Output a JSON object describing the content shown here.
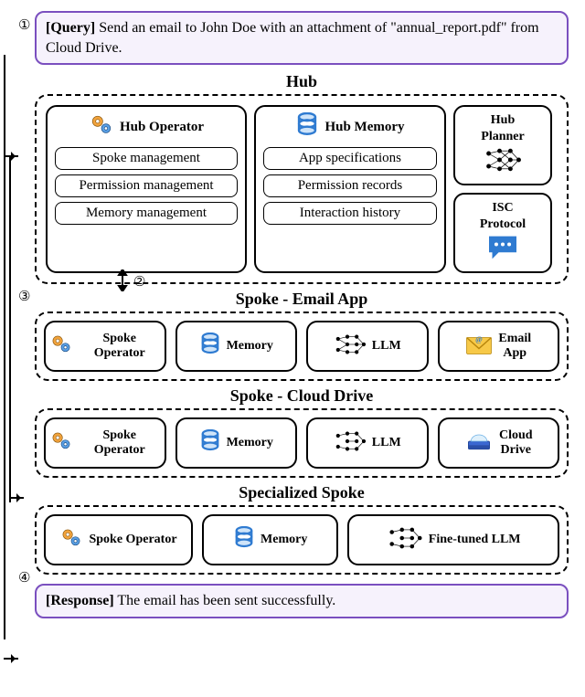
{
  "query": {
    "label": "[Query]",
    "text": "Send an email to John Doe with an attachment of \"annual_report.pdf\" from Cloud Drive."
  },
  "steps": {
    "s1": "①",
    "s2": "②",
    "s3": "③",
    "s4": "④"
  },
  "hub": {
    "title": "Hub",
    "operator": {
      "title": "Hub Operator",
      "items": [
        "Spoke management",
        "Permission management",
        "Memory management"
      ]
    },
    "memory": {
      "title": "Hub Memory",
      "items": [
        "App specifications",
        "Permission records",
        "Interaction history"
      ]
    },
    "planner": {
      "title_l1": "Hub",
      "title_l2": "Planner"
    },
    "isc": {
      "title_l1": "ISC",
      "title_l2": "Protocol"
    }
  },
  "spoke_email": {
    "title": "Spoke - Email App",
    "operator": "Spoke Operator",
    "memory": "Memory",
    "llm": "LLM",
    "app_l1": "Email",
    "app_l2": "App"
  },
  "spoke_cloud": {
    "title": "Spoke - Cloud Drive",
    "operator": "Spoke Operator",
    "memory": "Memory",
    "llm": "LLM",
    "app_l1": "Cloud",
    "app_l2": "Drive"
  },
  "spoke_special": {
    "title": "Specialized Spoke",
    "operator": "Spoke Operator",
    "memory": "Memory",
    "llm": "Fine-tuned LLM"
  },
  "response": {
    "label": "[Response]",
    "text": "The email has been sent successfully."
  }
}
